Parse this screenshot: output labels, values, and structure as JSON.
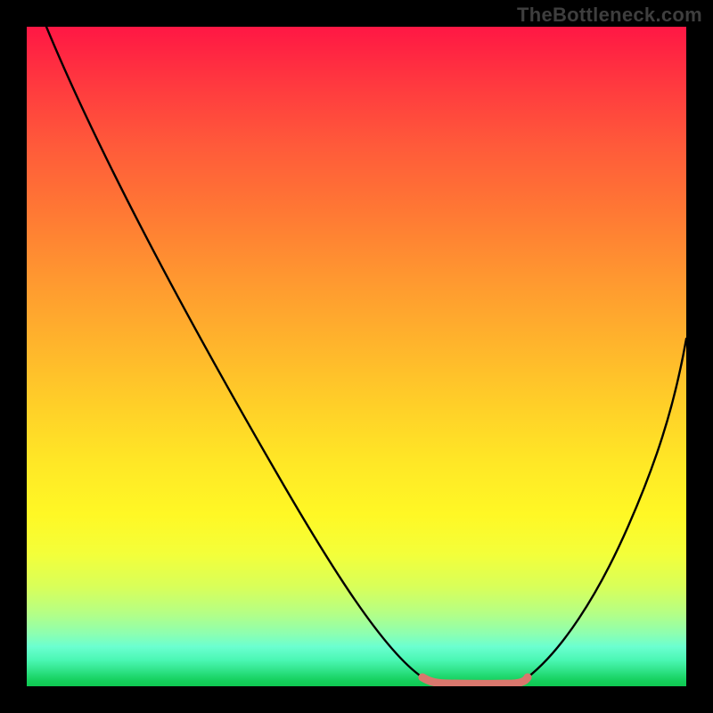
{
  "watermark": "TheBottleneck.com",
  "chart_data": {
    "type": "line",
    "title": "",
    "xlabel": "",
    "ylabel": "",
    "xlim": [
      0,
      100
    ],
    "ylim": [
      0,
      100
    ],
    "series": [
      {
        "name": "bottleneck-curve-left",
        "x": [
          3,
          10,
          20,
          30,
          40,
          50,
          58,
          60
        ],
        "values": [
          100,
          88,
          71,
          54,
          37,
          19,
          4,
          1
        ],
        "color": "#000000"
      },
      {
        "name": "bottleneck-curve-right",
        "x": [
          76,
          80,
          85,
          90,
          95,
          100
        ],
        "values": [
          1,
          5,
          14,
          26,
          39,
          53
        ],
        "color": "#000000"
      },
      {
        "name": "optimal-range",
        "x": [
          60,
          63,
          66,
          69,
          72,
          75,
          76
        ],
        "values": [
          1.2,
          0.5,
          0.4,
          0.4,
          0.4,
          0.6,
          1.2
        ],
        "color": "#d9776d"
      }
    ],
    "gradient_stops": [
      {
        "pct": 0,
        "color": "#ff1744"
      },
      {
        "pct": 50,
        "color": "#ffd024"
      },
      {
        "pct": 80,
        "color": "#f5ff30"
      },
      {
        "pct": 100,
        "color": "#0fc951"
      }
    ]
  }
}
